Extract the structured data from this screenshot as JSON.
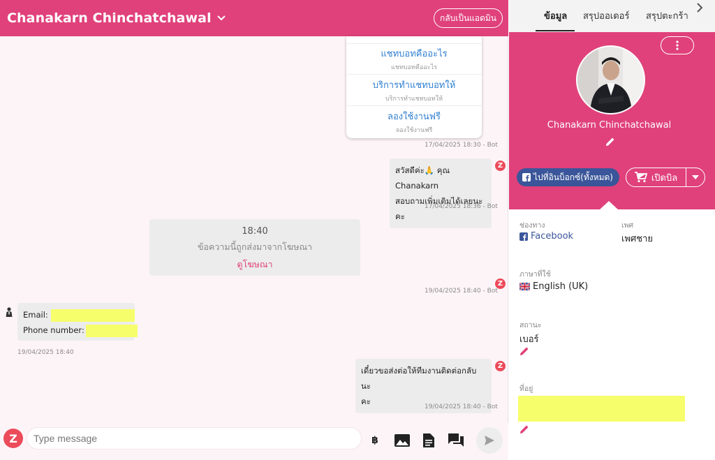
{
  "header": {
    "title": "Chanakarn Chinchatchawal",
    "admin_button": "กลับเป็นแอดมิน"
  },
  "card_buttons": [
    {
      "title": "แชทบอทคืออะไร",
      "subtitle": "แชทบอทคืออะไร"
    },
    {
      "title": "บริการทำแชทบอทให้",
      "subtitle": "บริการทำแชทบอทให้"
    },
    {
      "title": "ลองใช้งานฟรี",
      "subtitle": "ลองใช้งานฟรี"
    }
  ],
  "messages": {
    "ts_card": "17/04/2025 18:30 - Bot",
    "greet_line1": "สวัสดีค่ะ🙏 คุณ Chanakarn",
    "greet_line2": "สอบถามเพิ่มเติมได้เลยนะคะ",
    "ts_greet": "17/04/2025 18:36 - Bot",
    "ad_time": "18:40",
    "ad_message": "ข้อความนี้ถูกส่งมาจากโฆษณา",
    "ad_link": "ดูโฆษณา",
    "ts_ad": "19/04/2025 18:40 - Bot",
    "email_label": "Email:",
    "phone_label": "Phone number:",
    "ts_user": "19/04/2025 18:40",
    "handoff_line1": "เดี๋ยวขอส่งต่อให้ทีมงานติดต่อกลับนะ",
    "handoff_line2": "คะ",
    "ts_handoff": "19/04/2025 18:40 - Bot"
  },
  "composer": {
    "placeholder": "Type message",
    "baht_symbol": "฿"
  },
  "sidebar": {
    "tabs": [
      "ข้อมูล",
      "สรุปออเดอร์",
      "สรุปตะกร้า"
    ],
    "active_tab": "ข้อมูล",
    "profile_name": "Chanakarn Chinchatchawal",
    "inbox_button": "ไปที่อินบ็อกซ์(ทั้งหมด)",
    "bill_button": "เปิดบิล",
    "fields": {
      "channel_label": "ช่องทาง",
      "channel_value": "Facebook",
      "gender_label": "เพศ",
      "gender_value": "เพศชาย",
      "language_label": "ภาษาที่ใช้",
      "language_value": "English (UK)",
      "status_label": "สถานะ",
      "status_value": "เบอร์",
      "address_label": "ที่อยู่"
    }
  },
  "colors": {
    "brand_pink": "#e0417a",
    "facebook_blue": "#3a5599",
    "link_blue": "#2f7fd1",
    "redacted_highlight": "#f6ff6b"
  }
}
